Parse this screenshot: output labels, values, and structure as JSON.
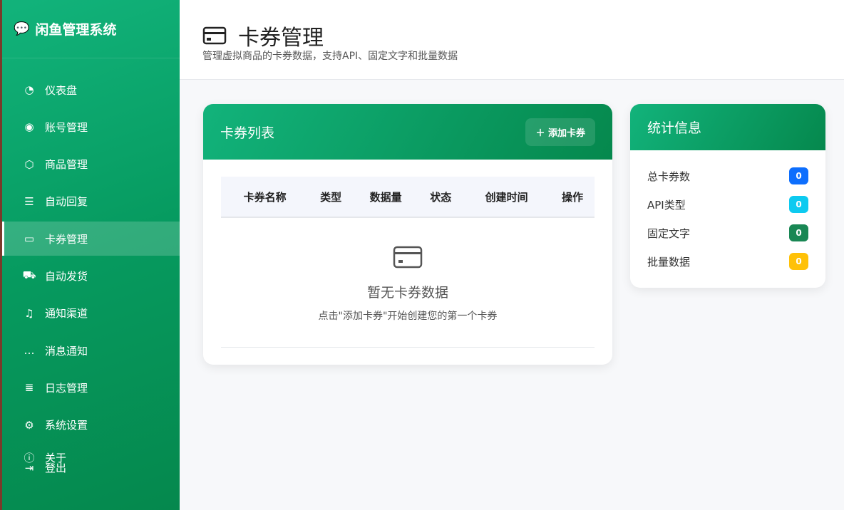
{
  "app": {
    "title": "闲鱼管理系统"
  },
  "sidebar": {
    "items": [
      {
        "label": "仪表盘",
        "icon": "speedometer-icon"
      },
      {
        "label": "账号管理",
        "icon": "user-circle-icon"
      },
      {
        "label": "商品管理",
        "icon": "box-icon"
      },
      {
        "label": "自动回复",
        "icon": "chat-square-icon"
      },
      {
        "label": "卡券管理",
        "icon": "credit-card-icon",
        "active": true
      },
      {
        "label": "自动发货",
        "icon": "truck-icon"
      },
      {
        "label": "通知渠道",
        "icon": "bell-icon"
      },
      {
        "label": "消息通知",
        "icon": "chat-dots-icon"
      },
      {
        "label": "日志管理",
        "icon": "journal-icon"
      },
      {
        "label": "系统设置",
        "icon": "gear-icon"
      }
    ],
    "about": "关于",
    "logout": "登出"
  },
  "header": {
    "title": "卡券管理",
    "subtitle": "管理虚拟商品的卡券数据，支持API、固定文字和批量数据"
  },
  "cards_panel": {
    "title": "卡券列表",
    "add_button": "添加卡券",
    "columns": [
      "卡券名称",
      "类型",
      "数据量",
      "状态",
      "创建时间",
      "操作"
    ],
    "empty_title": "暂无卡券数据",
    "empty_hint": "点击\"添加卡券\"开始创建您的第一个卡券"
  },
  "stats": {
    "title": "统计信息",
    "rows": [
      {
        "label": "总卡券数",
        "value": "0",
        "color": "#0d6efd"
      },
      {
        "label": "API类型",
        "value": "0",
        "color": "#0dcaf0"
      },
      {
        "label": "固定文字",
        "value": "0",
        "color": "#198754"
      },
      {
        "label": "批量数据",
        "value": "0",
        "color": "#ffc107"
      }
    ]
  }
}
